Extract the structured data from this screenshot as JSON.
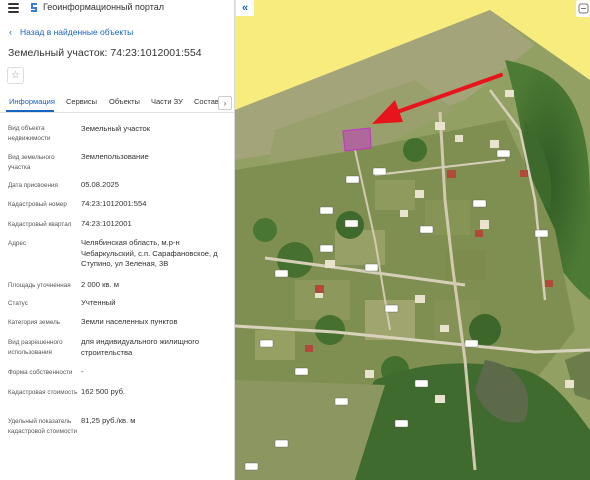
{
  "header": {
    "portal_title": "Геоинформационный портал"
  },
  "nav": {
    "back_label": "Назад в найденные объекты"
  },
  "object": {
    "title": "Земельный участок: 74:23:1012001:554"
  },
  "tabs": [
    {
      "label": "Информация"
    },
    {
      "label": "Сервисы"
    },
    {
      "label": "Объекты"
    },
    {
      "label": "Части ЗУ"
    },
    {
      "label": "Состав"
    }
  ],
  "fields": [
    {
      "label": "Вид объекта недвижимости",
      "value": "Земельный участок"
    },
    {
      "label": "Вид земельного участка",
      "value": "Землепользование"
    },
    {
      "label": "Дата присвоения",
      "value": "05.08.2025"
    },
    {
      "label": "Кадастровый номер",
      "value": "74:23:1012001:554"
    },
    {
      "label": "Кадастровый квартал",
      "value": "74:23:1012001"
    },
    {
      "label": "Адрес",
      "value": "Челябинская область, м.р-н Чебаркульский, с.п. Сарафановское, д Ступино, ул Зеленая, 3В"
    },
    {
      "label": "Площадь уточненная",
      "value": "2 000 кв. м"
    },
    {
      "label": "Статус",
      "value": "Учтенный"
    },
    {
      "label": "Категория земель",
      "value": "Земли населенных пунктов"
    },
    {
      "label": "Вид разрешенного использования",
      "value": "для индивидуального жилищного строительства"
    },
    {
      "label": "Форма собственности",
      "value": "-"
    },
    {
      "label": "Кадастровая стоимость",
      "value": "162 500 руб."
    },
    {
      "label": "Удельный показатель кадастровой стоимости",
      "value": "81,25 руб./кв. м"
    }
  ],
  "colors": {
    "accent": "#1565c0",
    "map_background": "#f8ec7f",
    "parcel_highlight": "#c03cc0",
    "arrow": "#e8141b"
  },
  "icons": {
    "menu": "hamburger-icon",
    "logo": "portal-logo-icon",
    "back": "chevron-left-icon",
    "favorite": "star-icon",
    "tabs_next": "chevron-right-icon",
    "collapse": "double-chevron-left-icon",
    "layers": "layers-icon"
  }
}
